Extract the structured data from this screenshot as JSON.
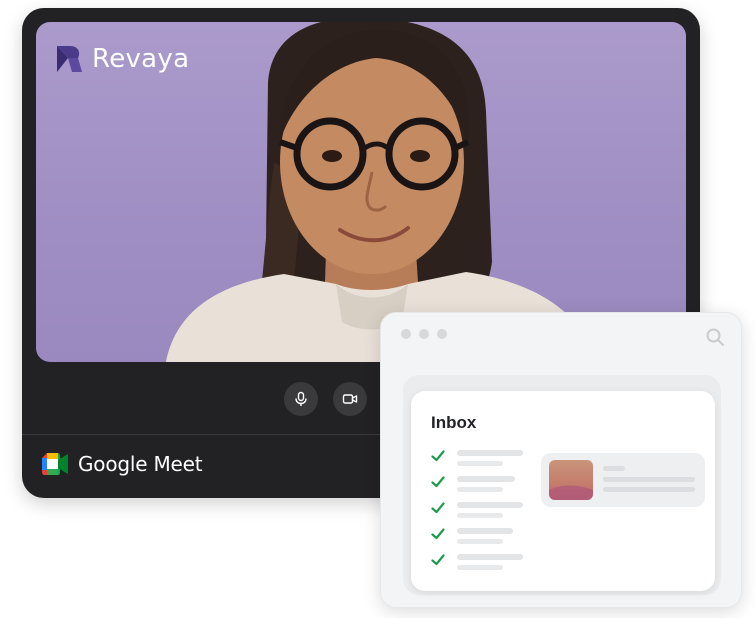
{
  "meet_window": {
    "brand_name": "Revaya",
    "app_name": "Google Meet",
    "controls": [
      {
        "icon": "microphone-icon"
      },
      {
        "icon": "camera-icon"
      }
    ]
  },
  "inbox_window": {
    "title": "Inbox",
    "window_buttons": 3,
    "toolbar_icon": "search-icon",
    "email_items": [
      {
        "status_icon": "check-icon"
      },
      {
        "status_icon": "check-icon"
      },
      {
        "status_icon": "check-icon"
      },
      {
        "status_icon": "check-icon"
      },
      {
        "status_icon": "check-icon"
      }
    ]
  },
  "colors": {
    "video_background": "#a897c9",
    "frame": "#222224",
    "check": "#1e9b4f",
    "brand_mark": "#4a3a8a"
  }
}
